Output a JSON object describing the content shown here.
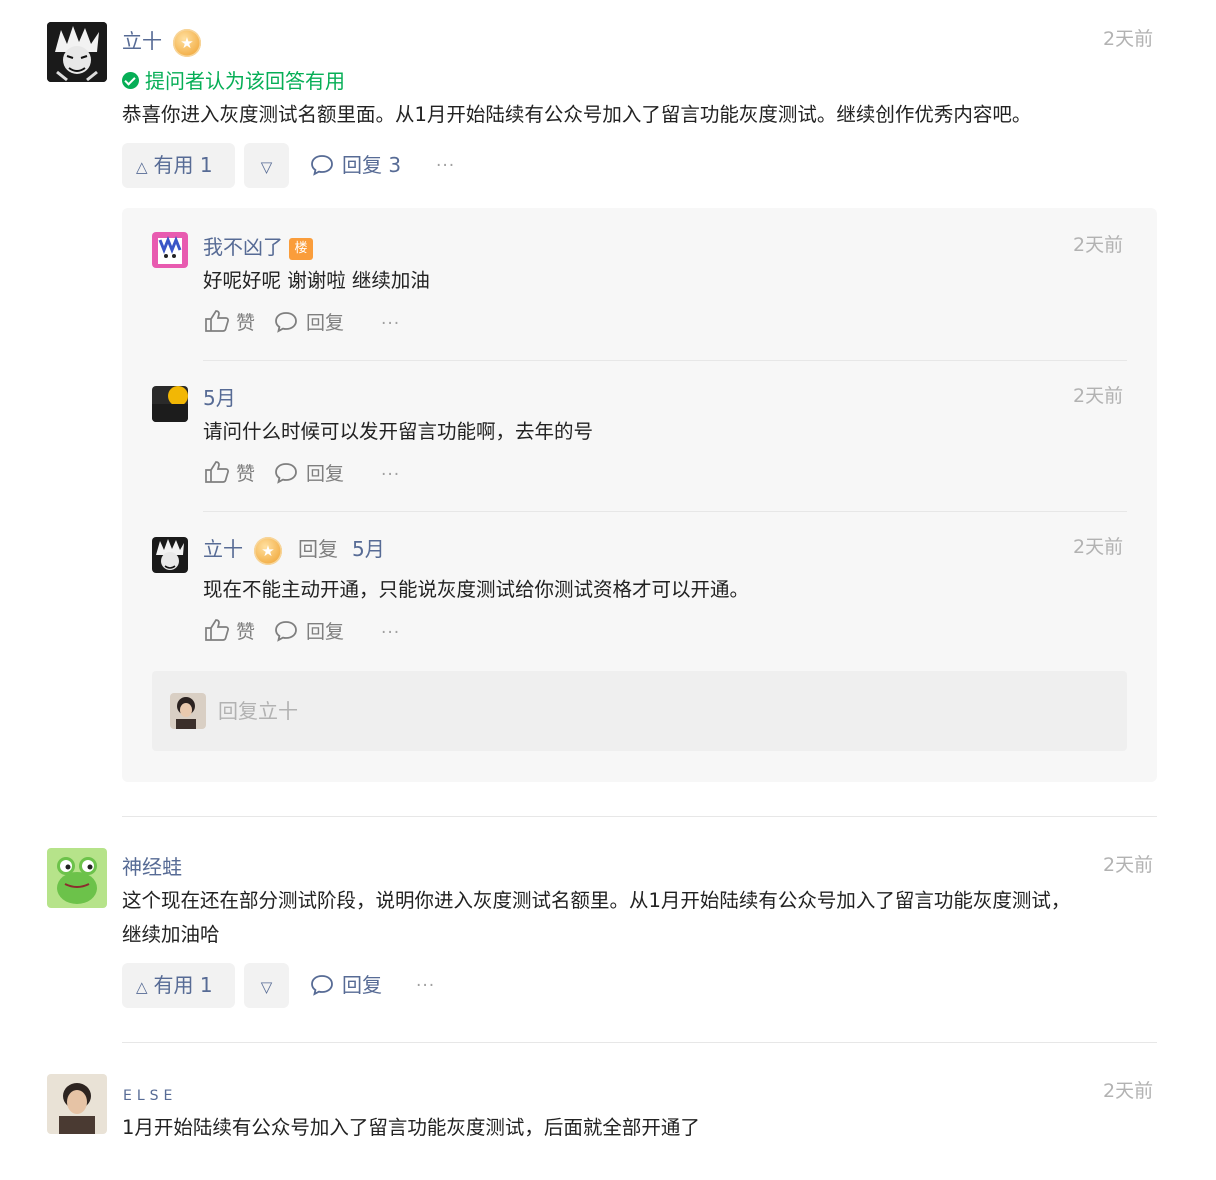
{
  "comments": [
    {
      "author": "立十",
      "time": "2天前",
      "accepted_label": "提问者认为该回答有用",
      "content": "恭喜你进入灰度测试名额里面。从1月开始陆续有公众号加入了留言功能灰度测试。继续创作优秀内容吧。",
      "useful_label": "有用 1",
      "reply_label": "回复 3",
      "more": "···",
      "replies": [
        {
          "author": "我不凶了",
          "floor_tag": "楼",
          "time": "2天前",
          "content": "好呢好呢 谢谢啦 继续加油",
          "like_label": "赞",
          "reply_label": "回复",
          "more": "···"
        },
        {
          "author": "5月",
          "time": "2天前",
          "content": "请问什么时候可以发开留言功能啊，去年的号",
          "like_label": "赞",
          "reply_label": "回复",
          "more": "···"
        },
        {
          "author": "立十",
          "reply_word": "回复",
          "reply_to": "5月",
          "time": "2天前",
          "content": "现在不能主动开通，只能说灰度测试给你测试资格才可以开通。",
          "like_label": "赞",
          "reply_label": "回复",
          "more": "···"
        }
      ],
      "reply_placeholder": "回复立十"
    },
    {
      "author": "神经蛙",
      "time": "2天前",
      "content_line1": "这个现在还在部分测试阶段，说明你进入灰度测试名额里。从1月开始陆续有公众号加入了留言功能灰度测试，",
      "content_line2": "继续加油哈",
      "useful_label": "有用 1",
      "reply_label": "回复",
      "more": "···"
    },
    {
      "author": "ELSE",
      "time": "2天前",
      "content": "1月开始陆续有公众号加入了留言功能灰度测试，后面就全部开通了"
    }
  ],
  "colors": {
    "link": "#576b95",
    "green": "#06ae56",
    "time": "#b2b2b2",
    "thread_bg": "#f7f7f7",
    "floor_tag": "#fa9d3b"
  },
  "icons": {
    "accepted": "check-circle-icon",
    "upvote": "triangle-up-icon",
    "downvote": "triangle-down-icon",
    "reply": "speech-bubble-icon",
    "like": "thumbs-up-icon",
    "more": "ellipsis-icon",
    "badge": "star-badge-icon"
  }
}
